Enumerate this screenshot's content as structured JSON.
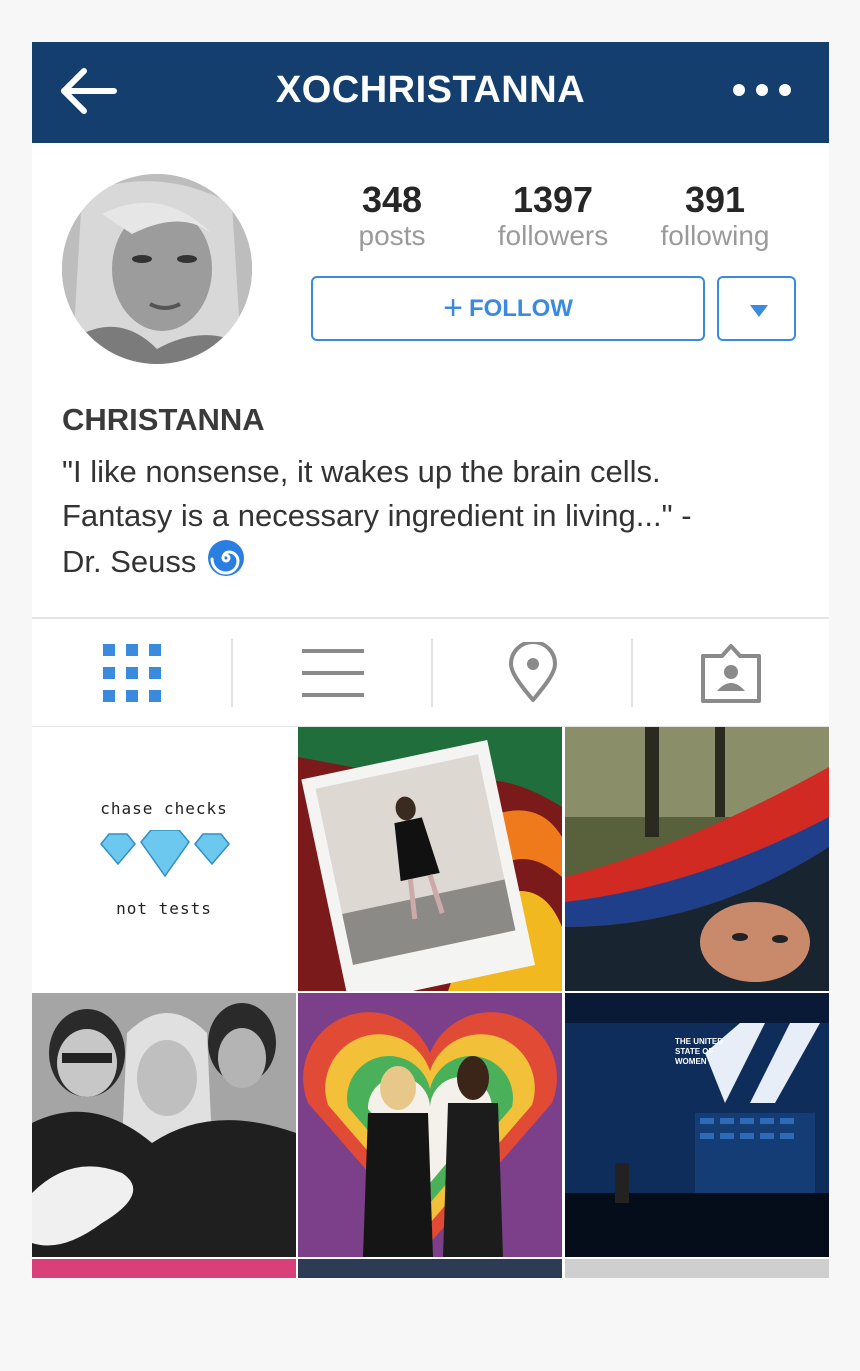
{
  "header": {
    "username": "XOCHRISTANNA",
    "back_icon": "back-arrow-icon",
    "more_icon": "more-options-icon",
    "background": "#133e6e"
  },
  "profile": {
    "stats": [
      {
        "value": "348",
        "label": "posts"
      },
      {
        "value": "1397",
        "label": "followers"
      },
      {
        "value": "391",
        "label": "following"
      }
    ],
    "follow_label": "FOLLOW",
    "display_name": "CHRISTANNA",
    "bio_lines": [
      "\"I like nonsense, it wakes up the brain cells.",
      "Fantasy is a necessary ingredient in living...\" -",
      "Dr. Seuss"
    ],
    "accent": "#3a8be0"
  },
  "tabs": [
    {
      "name": "grid-view-icon",
      "active": true
    },
    {
      "name": "list-view-icon",
      "active": false
    },
    {
      "name": "location-pin-icon",
      "active": false
    },
    {
      "name": "tagged-photos-icon",
      "active": false
    }
  ],
  "posts": {
    "first_post_text": [
      "chase checks",
      "not tests"
    ],
    "banner_text": [
      "THE UNITED",
      "STATE OF",
      "WOMEN"
    ]
  }
}
